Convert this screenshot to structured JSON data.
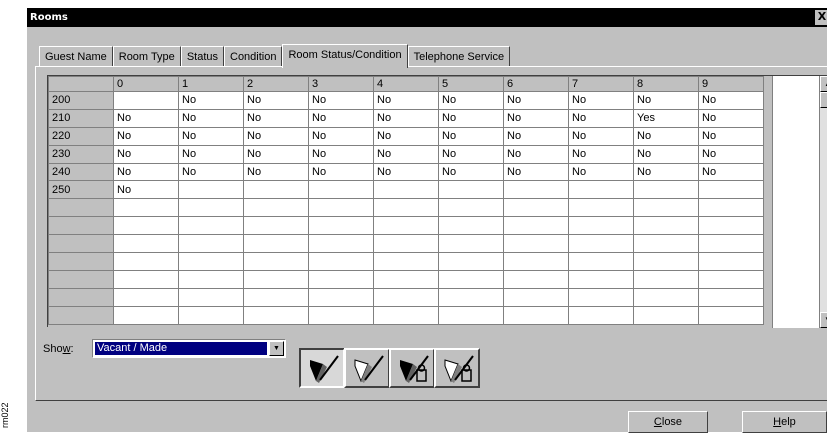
{
  "figure_id": "rm022",
  "window": {
    "title": "Rooms",
    "close_glyph": "X"
  },
  "tabs": [
    {
      "label": "Guest Name",
      "active": false
    },
    {
      "label": "Room Type",
      "active": false
    },
    {
      "label": "Status",
      "active": false
    },
    {
      "label": "Condition",
      "active": false
    },
    {
      "label": "Room Status/Condition",
      "active": true
    },
    {
      "label": "Telephone Service",
      "active": false
    }
  ],
  "grid": {
    "column_headers": [
      "0",
      "1",
      "2",
      "3",
      "4",
      "5",
      "6",
      "7",
      "8",
      "9"
    ],
    "rows": [
      {
        "header": "200",
        "cells": [
          "",
          "No",
          "No",
          "No",
          "No",
          "No",
          "No",
          "No",
          "No",
          "No"
        ]
      },
      {
        "header": "210",
        "cells": [
          "No",
          "No",
          "No",
          "No",
          "No",
          "No",
          "No",
          "No",
          "Yes",
          "No"
        ]
      },
      {
        "header": "220",
        "cells": [
          "No",
          "No",
          "No",
          "No",
          "No",
          "No",
          "No",
          "No",
          "No",
          "No"
        ]
      },
      {
        "header": "230",
        "cells": [
          "No",
          "No",
          "No",
          "No",
          "No",
          "No",
          "No",
          "No",
          "No",
          "No"
        ]
      },
      {
        "header": "240",
        "cells": [
          "No",
          "No",
          "No",
          "No",
          "No",
          "No",
          "No",
          "No",
          "No",
          "No"
        ]
      },
      {
        "header": "250",
        "cells": [
          "No",
          "",
          "",
          "",
          "",
          "",
          "",
          "",
          "",
          ""
        ]
      },
      {
        "header": "",
        "cells": [
          "",
          "",
          "",
          "",
          "",
          "",
          "",
          "",
          "",
          ""
        ]
      },
      {
        "header": "",
        "cells": [
          "",
          "",
          "",
          "",
          "",
          "",
          "",
          "",
          "",
          ""
        ]
      },
      {
        "header": "",
        "cells": [
          "",
          "",
          "",
          "",
          "",
          "",
          "",
          "",
          "",
          ""
        ]
      },
      {
        "header": "",
        "cells": [
          "",
          "",
          "",
          "",
          "",
          "",
          "",
          "",
          "",
          ""
        ]
      },
      {
        "header": "",
        "cells": [
          "",
          "",
          "",
          "",
          "",
          "",
          "",
          "",
          "",
          ""
        ]
      },
      {
        "header": "",
        "cells": [
          "",
          "",
          "",
          "",
          "",
          "",
          "",
          "",
          "",
          ""
        ]
      },
      {
        "header": "",
        "cells": [
          "",
          "",
          "",
          "",
          "",
          "",
          "",
          "",
          "",
          ""
        ]
      }
    ]
  },
  "show": {
    "label_prefix": "Sho",
    "label_mnemonic": "w",
    "label_suffix": ":",
    "selected": "Vacant / Made"
  },
  "icon_buttons": [
    {
      "icon": "vacant-made-icon",
      "pressed": true
    },
    {
      "icon": "vacant-dirty-icon",
      "pressed": false
    },
    {
      "icon": "occupied-made-icon",
      "pressed": false
    },
    {
      "icon": "occupied-dirty-icon",
      "pressed": false
    }
  ],
  "buttons": {
    "close_mnemonic": "C",
    "close_rest": "lose",
    "help_mnemonic": "H",
    "help_rest": "elp"
  }
}
